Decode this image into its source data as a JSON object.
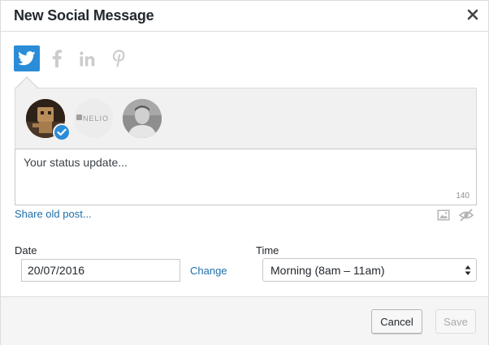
{
  "dialog": {
    "title": "New Social Message",
    "close_icon": "close-icon"
  },
  "networks": {
    "active": "twitter",
    "items": [
      {
        "name": "twitter",
        "icon": "twitter-bird-icon",
        "color": "#2b8cd8"
      },
      {
        "name": "facebook",
        "icon": "facebook-icon",
        "color": "#cccccc"
      },
      {
        "name": "linkedin",
        "icon": "linkedin-icon",
        "color": "#cccccc"
      },
      {
        "name": "pinterest",
        "icon": "pinterest-icon",
        "color": "#cccccc"
      }
    ]
  },
  "profiles": {
    "nelio_logo_text": "NELIO",
    "selected_badge_icon": "checkmark-icon"
  },
  "composer": {
    "placeholder": "Your status update...",
    "char_count": "140",
    "share_old_label": "Share old post..."
  },
  "schedule": {
    "date_label": "Date",
    "date_value": "20/07/2016",
    "change_label": "Change",
    "time_label": "Time",
    "time_value": "Morning (8am – 11am)"
  },
  "footer": {
    "cancel_label": "Cancel",
    "save_label": "Save"
  },
  "colors": {
    "accent": "#2b8cd8",
    "link": "#1e6fa8"
  }
}
